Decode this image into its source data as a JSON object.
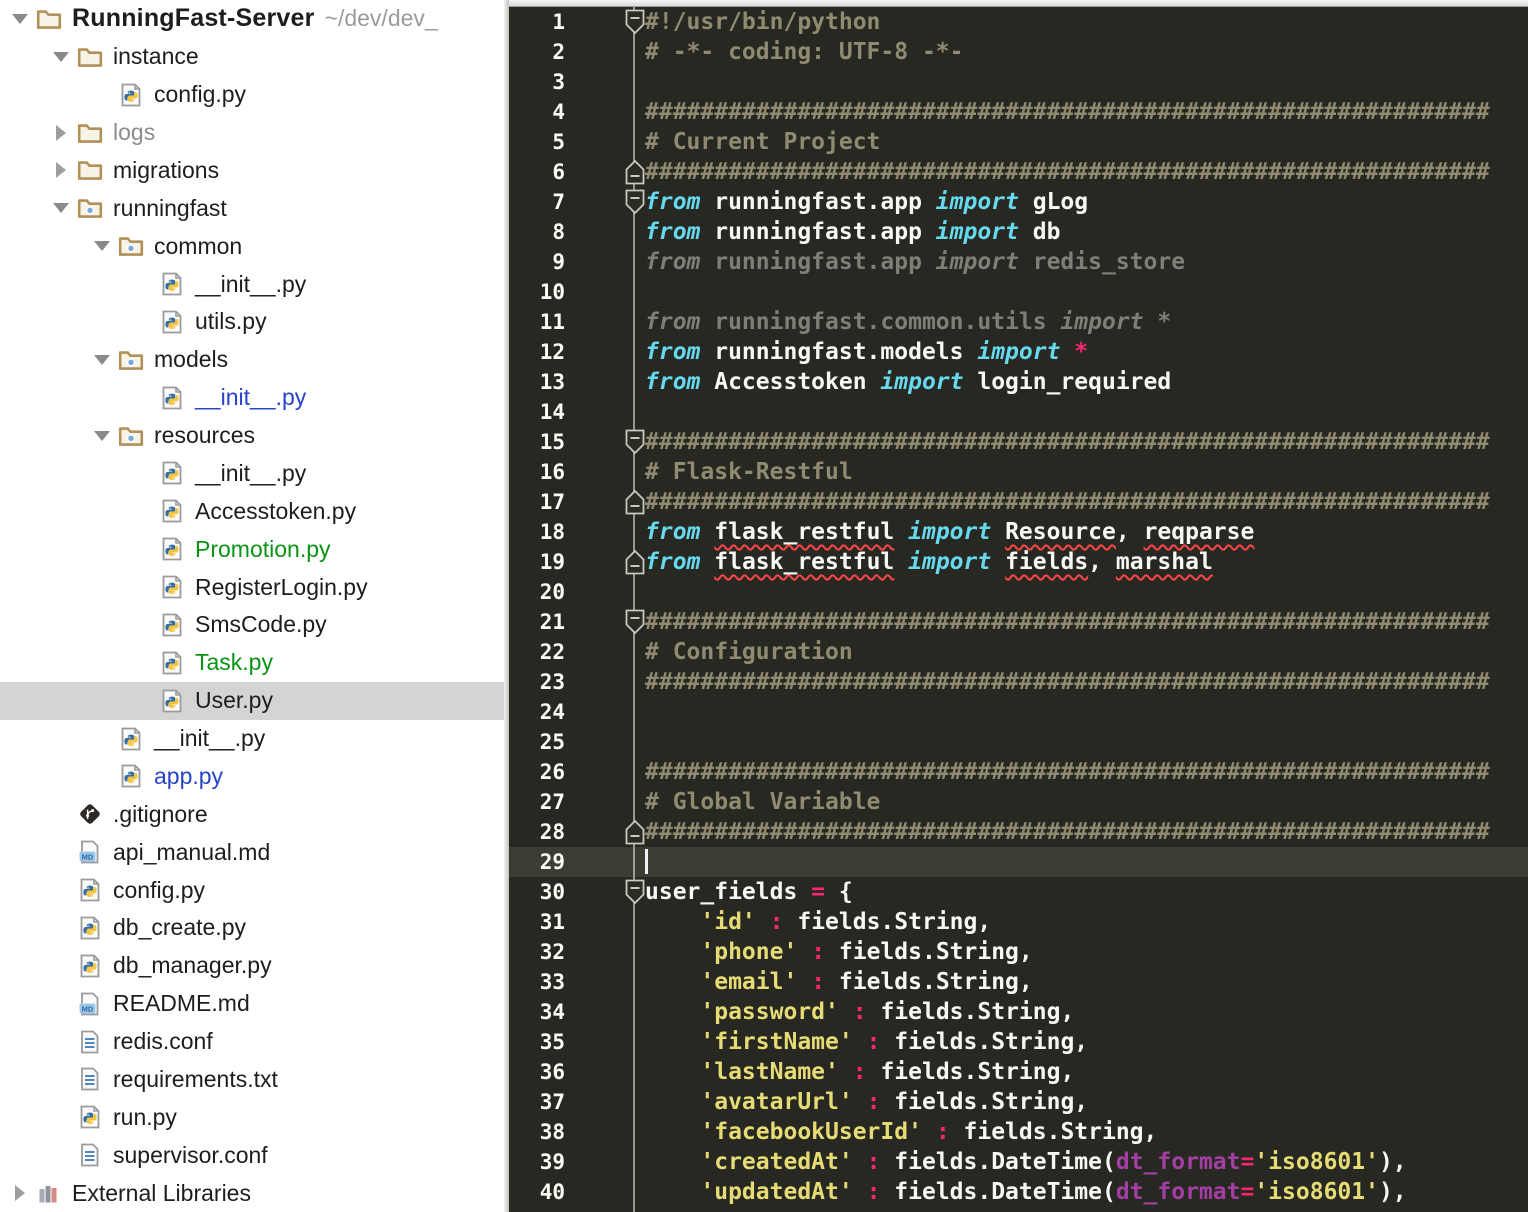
{
  "colors": {
    "editor_background": "#272822",
    "editor_active_line": "#3c3c33",
    "comment": "#8f8a70",
    "keyword": "#66d9ef",
    "plain_text": "#f8f8f2",
    "pink_operator": "#f92672",
    "string_yellow": "#e6db74",
    "param_purple": "#a43ea4",
    "unused_gray": "#7f7f77",
    "error_underline": "#ff4545",
    "tree_selected_background": "#d4d4d4",
    "file_status": {
      "blue": "#2743c9",
      "green": "#0a9314",
      "gray": "#8c8c8c",
      "black": "#1d1d1d"
    }
  },
  "project_tree": {
    "rows": [
      {
        "label": "RunningFast-Server",
        "suffix": "~/dev/dev_",
        "level": 0,
        "icon": "folder",
        "arrow": "expanded",
        "bold": true
      },
      {
        "label": "instance",
        "level": 1,
        "icon": "folder",
        "arrow": "expanded"
      },
      {
        "label": "config.py",
        "level": 2,
        "icon": "py"
      },
      {
        "label": "logs",
        "level": 1,
        "icon": "folder",
        "arrow": "collapsed",
        "color": "gray"
      },
      {
        "label": "migrations",
        "level": 1,
        "icon": "folder",
        "arrow": "collapsed"
      },
      {
        "label": "runningfast",
        "level": 1,
        "icon": "package",
        "arrow": "expanded"
      },
      {
        "label": "common",
        "level": 2,
        "icon": "package",
        "arrow": "expanded"
      },
      {
        "label": "__init__.py",
        "level": 3,
        "icon": "py"
      },
      {
        "label": "utils.py",
        "level": 3,
        "icon": "py"
      },
      {
        "label": "models",
        "level": 2,
        "icon": "package",
        "arrow": "expanded"
      },
      {
        "label": "__init__.py",
        "level": 3,
        "icon": "py",
        "color": "blue"
      },
      {
        "label": "resources",
        "level": 2,
        "icon": "package",
        "arrow": "expanded"
      },
      {
        "label": "__init__.py",
        "level": 3,
        "icon": "py"
      },
      {
        "label": "Accesstoken.py",
        "level": 3,
        "icon": "py"
      },
      {
        "label": "Promotion.py",
        "level": 3,
        "icon": "py",
        "color": "green"
      },
      {
        "label": "RegisterLogin.py",
        "level": 3,
        "icon": "py"
      },
      {
        "label": "SmsCode.py",
        "level": 3,
        "icon": "py"
      },
      {
        "label": "Task.py",
        "level": 3,
        "icon": "py",
        "color": "green"
      },
      {
        "label": "User.py",
        "level": 3,
        "icon": "py",
        "selected": true
      },
      {
        "label": "__init__.py",
        "level": 2,
        "icon": "py"
      },
      {
        "label": "app.py",
        "level": 2,
        "icon": "py",
        "color": "blue"
      },
      {
        "label": ".gitignore",
        "level": 1,
        "icon": "git"
      },
      {
        "label": "api_manual.md",
        "level": 1,
        "icon": "md"
      },
      {
        "label": "config.py",
        "level": 1,
        "icon": "py"
      },
      {
        "label": "db_create.py",
        "level": 1,
        "icon": "py"
      },
      {
        "label": "db_manager.py",
        "level": 1,
        "icon": "py"
      },
      {
        "label": "README.md",
        "level": 1,
        "icon": "md"
      },
      {
        "label": "redis.conf",
        "level": 1,
        "icon": "txt"
      },
      {
        "label": "requirements.txt",
        "level": 1,
        "icon": "txt"
      },
      {
        "label": "run.py",
        "level": 1,
        "icon": "py"
      },
      {
        "label": "supervisor.conf",
        "level": 1,
        "icon": "txt"
      },
      {
        "label": "External Libraries",
        "level": 0,
        "icon": "lib",
        "arrow": "collapsed"
      }
    ]
  },
  "editor": {
    "active_line": 29,
    "fold_markers": [
      {
        "line": 1,
        "type": "start"
      },
      {
        "line": 6,
        "type": "end"
      },
      {
        "line": 7,
        "type": "start"
      },
      {
        "line": 15,
        "type": "start"
      },
      {
        "line": 17,
        "type": "end"
      },
      {
        "line": 19,
        "type": "end"
      },
      {
        "line": 21,
        "type": "start"
      },
      {
        "line": 28,
        "type": "end"
      },
      {
        "line": 30,
        "type": "start"
      }
    ],
    "lines": [
      {
        "n": 1,
        "t": [
          [
            "cm",
            "#!/usr/bin/python"
          ]
        ]
      },
      {
        "n": 2,
        "t": [
          [
            "cm",
            "# -*- coding: UTF-8 -*-"
          ]
        ]
      },
      {
        "n": 3,
        "t": []
      },
      {
        "n": 4,
        "t": [
          [
            "cm",
            "#############################################################"
          ]
        ]
      },
      {
        "n": 5,
        "t": [
          [
            "cm",
            "# Current Project"
          ]
        ]
      },
      {
        "n": 6,
        "t": [
          [
            "cm",
            "#############################################################"
          ]
        ]
      },
      {
        "n": 7,
        "t": [
          [
            "kw",
            "from"
          ],
          [
            "pl",
            " runningfast.app "
          ],
          [
            "kw",
            "import"
          ],
          [
            "pl",
            " gLog"
          ]
        ]
      },
      {
        "n": 8,
        "t": [
          [
            "kw",
            "from"
          ],
          [
            "pl",
            " runningfast.app "
          ],
          [
            "kw",
            "import"
          ],
          [
            "pl",
            " db"
          ]
        ]
      },
      {
        "n": 9,
        "t": [
          [
            "grk",
            "from"
          ],
          [
            "gr",
            " runningfast.app "
          ],
          [
            "grk",
            "import"
          ],
          [
            "gr",
            " redis_store"
          ]
        ]
      },
      {
        "n": 10,
        "t": []
      },
      {
        "n": 11,
        "t": [
          [
            "grk",
            "from"
          ],
          [
            "gr",
            " runningfast.common.utils "
          ],
          [
            "grk",
            "import"
          ],
          [
            "gr",
            " *"
          ]
        ]
      },
      {
        "n": 12,
        "t": [
          [
            "kw",
            "from"
          ],
          [
            "pl",
            " runningfast.models "
          ],
          [
            "kw",
            "import"
          ],
          [
            "pl",
            " "
          ],
          [
            "pk",
            "*"
          ]
        ]
      },
      {
        "n": 13,
        "t": [
          [
            "kw",
            "from"
          ],
          [
            "pl",
            " Accesstoken "
          ],
          [
            "kw",
            "import"
          ],
          [
            "pl",
            " login_required"
          ]
        ]
      },
      {
        "n": 14,
        "t": []
      },
      {
        "n": 15,
        "t": [
          [
            "cm",
            "#############################################################"
          ]
        ]
      },
      {
        "n": 16,
        "t": [
          [
            "cm",
            "# Flask-Restful"
          ]
        ]
      },
      {
        "n": 17,
        "t": [
          [
            "cm",
            "#############################################################"
          ]
        ]
      },
      {
        "n": 18,
        "t": [
          [
            "kw",
            "from"
          ],
          [
            "pl",
            " "
          ],
          [
            "er",
            "flask_restful"
          ],
          [
            "pl",
            " "
          ],
          [
            "kw",
            "import"
          ],
          [
            "pl",
            " "
          ],
          [
            "er",
            "Resource"
          ],
          [
            "pl",
            ", "
          ],
          [
            "er",
            "reqparse"
          ]
        ]
      },
      {
        "n": 19,
        "t": [
          [
            "kw",
            "from"
          ],
          [
            "pl",
            " "
          ],
          [
            "er",
            "flask_restful"
          ],
          [
            "pl",
            " "
          ],
          [
            "kw",
            "import"
          ],
          [
            "pl",
            " "
          ],
          [
            "er",
            "fields"
          ],
          [
            "pl",
            ", "
          ],
          [
            "er",
            "marshal"
          ]
        ]
      },
      {
        "n": 20,
        "t": []
      },
      {
        "n": 21,
        "t": [
          [
            "cm",
            "#############################################################"
          ]
        ]
      },
      {
        "n": 22,
        "t": [
          [
            "cm",
            "# Configuration"
          ]
        ]
      },
      {
        "n": 23,
        "t": [
          [
            "cm",
            "#############################################################"
          ]
        ]
      },
      {
        "n": 24,
        "t": []
      },
      {
        "n": 25,
        "t": []
      },
      {
        "n": 26,
        "t": [
          [
            "cm",
            "#############################################################"
          ]
        ]
      },
      {
        "n": 27,
        "t": [
          [
            "cm",
            "# Global Variable"
          ]
        ]
      },
      {
        "n": 28,
        "t": [
          [
            "cm",
            "#############################################################"
          ]
        ]
      },
      {
        "n": 29,
        "t": []
      },
      {
        "n": 30,
        "t": [
          [
            "pl",
            "user_fields "
          ],
          [
            "pk",
            "="
          ],
          [
            "pl",
            " {"
          ]
        ]
      },
      {
        "n": 31,
        "t": [
          [
            "pl",
            "    "
          ],
          [
            "st",
            "'id'"
          ],
          [
            "pl",
            " "
          ],
          [
            "pk",
            ":"
          ],
          [
            "pl",
            " fields.String,"
          ]
        ]
      },
      {
        "n": 32,
        "t": [
          [
            "pl",
            "    "
          ],
          [
            "st",
            "'phone'"
          ],
          [
            "pl",
            " "
          ],
          [
            "pk",
            ":"
          ],
          [
            "pl",
            " fields.String,"
          ]
        ]
      },
      {
        "n": 33,
        "t": [
          [
            "pl",
            "    "
          ],
          [
            "st",
            "'email'"
          ],
          [
            "pl",
            " "
          ],
          [
            "pk",
            ":"
          ],
          [
            "pl",
            " fields.String,"
          ]
        ]
      },
      {
        "n": 34,
        "t": [
          [
            "pl",
            "    "
          ],
          [
            "st",
            "'password'"
          ],
          [
            "pl",
            " "
          ],
          [
            "pk",
            ":"
          ],
          [
            "pl",
            " fields.String,"
          ]
        ]
      },
      {
        "n": 35,
        "t": [
          [
            "pl",
            "    "
          ],
          [
            "st",
            "'firstName'"
          ],
          [
            "pl",
            " "
          ],
          [
            "pk",
            ":"
          ],
          [
            "pl",
            " fields.String,"
          ]
        ]
      },
      {
        "n": 36,
        "t": [
          [
            "pl",
            "    "
          ],
          [
            "st",
            "'lastName'"
          ],
          [
            "pl",
            " "
          ],
          [
            "pk",
            ":"
          ],
          [
            "pl",
            " fields.String,"
          ]
        ]
      },
      {
        "n": 37,
        "t": [
          [
            "pl",
            "    "
          ],
          [
            "st",
            "'avatarUrl'"
          ],
          [
            "pl",
            " "
          ],
          [
            "pk",
            ":"
          ],
          [
            "pl",
            " fields.String,"
          ]
        ]
      },
      {
        "n": 38,
        "t": [
          [
            "pl",
            "    "
          ],
          [
            "st",
            "'facebookUserId'"
          ],
          [
            "pl",
            " "
          ],
          [
            "pk",
            ":"
          ],
          [
            "pl",
            " fields.String,"
          ]
        ]
      },
      {
        "n": 39,
        "t": [
          [
            "pl",
            "    "
          ],
          [
            "st",
            "'createdAt'"
          ],
          [
            "pl",
            " "
          ],
          [
            "pk",
            ":"
          ],
          [
            "pl",
            " fields.DateTime("
          ],
          [
            "pr",
            "dt_format"
          ],
          [
            "pk",
            "="
          ],
          [
            "st",
            "'iso8601'"
          ],
          [
            "pl",
            "),"
          ]
        ]
      },
      {
        "n": 40,
        "t": [
          [
            "pl",
            "    "
          ],
          [
            "st",
            "'updatedAt'"
          ],
          [
            "pl",
            " "
          ],
          [
            "pk",
            ":"
          ],
          [
            "pl",
            " fields.DateTime("
          ],
          [
            "pr",
            "dt_format"
          ],
          [
            "pk",
            "="
          ],
          [
            "st",
            "'iso8601'"
          ],
          [
            "pl",
            "),"
          ]
        ]
      }
    ]
  }
}
